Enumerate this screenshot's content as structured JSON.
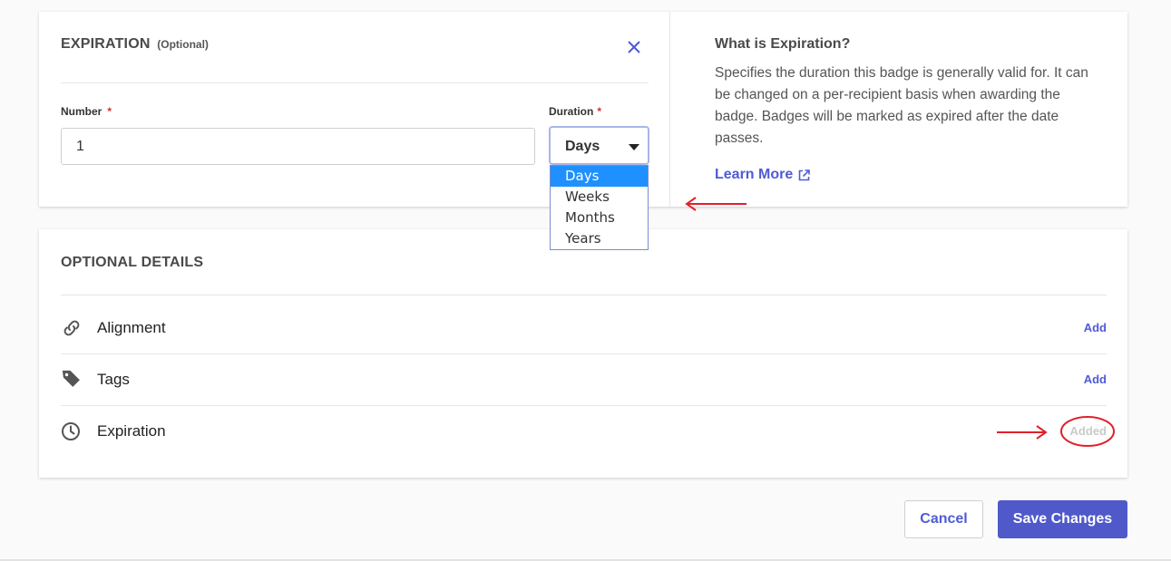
{
  "expiration": {
    "title": "EXPIRATION",
    "optional_label": "(Optional)",
    "number_label": "Number",
    "number_value": "1",
    "duration_label": "Duration",
    "required_mark": "*",
    "duration_value": "Days",
    "duration_options": [
      "Days",
      "Weeks",
      "Months",
      "Years"
    ],
    "selected_option": "Days"
  },
  "info": {
    "title": "What is Expiration?",
    "text": "Specifies the duration this badge is generally valid for. It can be changed on a per-recipient basis when awarding the badge. Badges will be marked as expired after the date passes.",
    "learn_more": "Learn More"
  },
  "optional_details": {
    "title": "OPTIONAL DETAILS",
    "rows": [
      {
        "label": "Alignment",
        "icon": "link-icon",
        "action": "Add"
      },
      {
        "label": "Tags",
        "icon": "tag-icon",
        "action": "Add"
      },
      {
        "label": "Expiration",
        "icon": "clock-icon",
        "action": "Added"
      }
    ]
  },
  "footer": {
    "cancel_label": "Cancel",
    "save_label": "Save Changes"
  },
  "colors": {
    "accent": "#5059c9",
    "link": "#4f5bd5",
    "required": "#d0322d",
    "annotation": "#e0202a",
    "dropdown_highlight": "#1e90ff"
  }
}
